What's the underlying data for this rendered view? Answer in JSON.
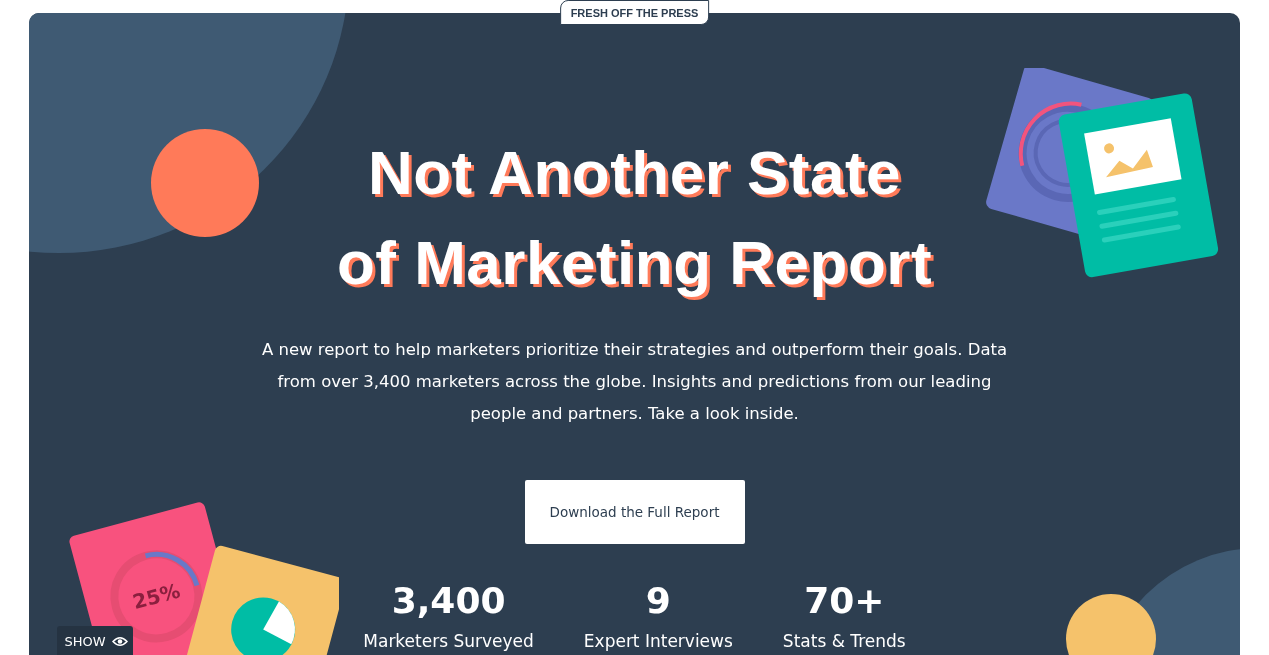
{
  "badge": "FRESH OFF THE PRESS",
  "title_lines": [
    "Not Another State",
    "of Marketing Report"
  ],
  "description": "A new report to help marketers prioritize their strategies and outperform their goals. Data from over 3,400 marketers across the globe. Insights and predictions from our leading people and partners. Take a look inside.",
  "cta_button": "Download the Full Report",
  "stats": [
    {
      "value": "3,400",
      "label": "Marketers Surveyed"
    },
    {
      "value": "9",
      "label": "Expert Interviews"
    },
    {
      "value": "70+",
      "label": "Stats & Trends"
    }
  ],
  "illustration_percent": "25%",
  "show_button": "SHOW"
}
